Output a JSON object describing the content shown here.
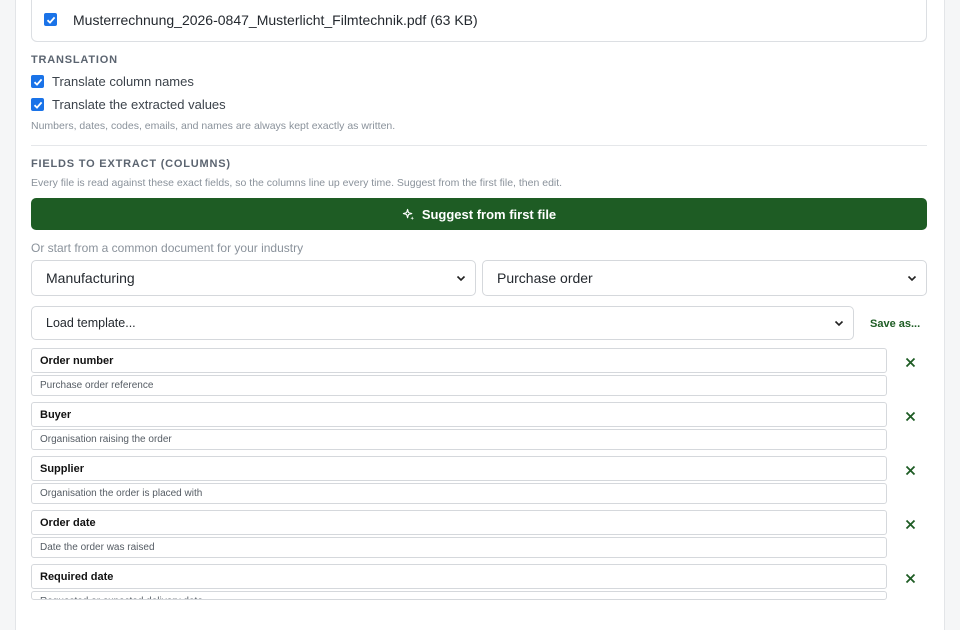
{
  "file": {
    "name": "Musterrechnung_2026-0847_Musterlicht_Filmtechnik.pdf (63 KB)",
    "checked": true
  },
  "translation": {
    "title": "TRANSLATION",
    "option1": "Translate column names",
    "option2": "Translate the extracted values",
    "hint": "Numbers, dates, codes, emails, and names are always kept exactly as written."
  },
  "fields_section": {
    "title": "FIELDS TO EXTRACT (COLUMNS)",
    "hint": "Every file is read against these exact fields, so the columns line up every time. Suggest from the first file, then edit.",
    "suggest_label": "Suggest from first file",
    "common_hint": "Or start from a common document for your industry",
    "industry_value": "Manufacturing",
    "doc_type_value": "Purchase order",
    "template_value": "Load template...",
    "save_as_label": "Save as..."
  },
  "fields": [
    {
      "name": "Order number",
      "desc": "Purchase order reference"
    },
    {
      "name": "Buyer",
      "desc": "Organisation raising the order"
    },
    {
      "name": "Supplier",
      "desc": "Organisation the order is placed with"
    },
    {
      "name": "Order date",
      "desc": "Date the order was raised"
    },
    {
      "name": "Required date",
      "desc": "Requested or expected delivery date"
    }
  ],
  "colors": {
    "accent_green": "#1e5c24",
    "checkbox_blue": "#1a73e8"
  }
}
